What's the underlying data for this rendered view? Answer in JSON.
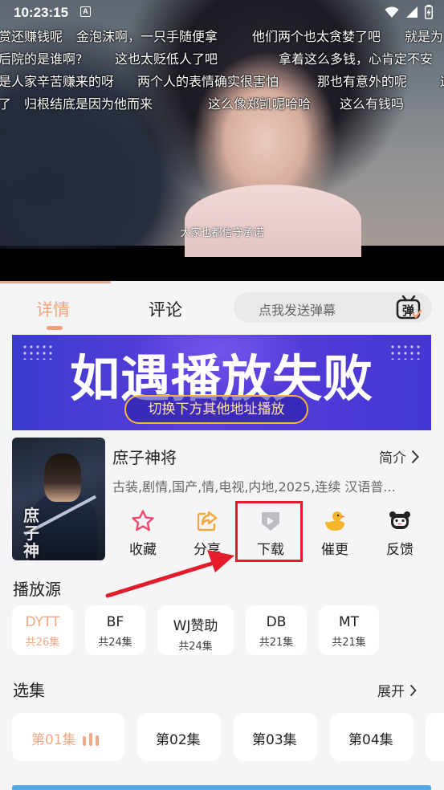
{
  "status": {
    "time": "10:23:15",
    "notice_glyph": "A"
  },
  "danmaku": {
    "row1": [
      "赏还赚钱呢",
      "金泡沫啊，一只手随便拿",
      "他们两个也太贪婪了吧",
      "就是为"
    ],
    "row2": [
      "后院的是谁啊?",
      "这也太贬低人了吧",
      "拿着这么多钱，心肯定不安"
    ],
    "row3": [
      "是人家辛苦赚来的呀",
      "两个人的表情确实很害怕",
      "那也有意外的呢",
      "这"
    ],
    "row4": [
      "了",
      "归根结底是因为他而来",
      "这么像郑凯呢哈哈",
      "这么有钱吗"
    ]
  },
  "subtitle": "大家也都信守承诺",
  "tabs": {
    "details": "详情",
    "comments": "评论"
  },
  "danmaku_input": {
    "placeholder": "点我发送弹幕",
    "icon_text": "弹"
  },
  "banner": {
    "title": "如遇播放失败",
    "subtitle": "切换下方其他地址播放"
  },
  "show": {
    "poster_title": "庶子神将",
    "title": "庶子神将",
    "synopsis_label": "简介",
    "tags": "古装,剧情,国产,情,电视,内地,2025,连续 汉语普..."
  },
  "actions": {
    "favorite": "收藏",
    "share": "分享",
    "download": "下载",
    "urge": "催更",
    "feedback": "反馈"
  },
  "sources": {
    "title": "播放源",
    "items": [
      {
        "name": "DYTT",
        "count": "共26集"
      },
      {
        "name": "BF",
        "count": "共24集"
      },
      {
        "name": "WJ赞助",
        "count": "共24集"
      },
      {
        "name": "DB",
        "count": "共21集"
      },
      {
        "name": "MT",
        "count": "共21集"
      }
    ]
  },
  "episodes": {
    "title": "选集",
    "expand_label": "展开",
    "items": [
      "第01集",
      "第02集",
      "第03集",
      "第04集"
    ]
  },
  "colors": {
    "accent": "#f2a078",
    "highlight_red": "#e41b2b",
    "banner_blue": "#4337d2"
  }
}
